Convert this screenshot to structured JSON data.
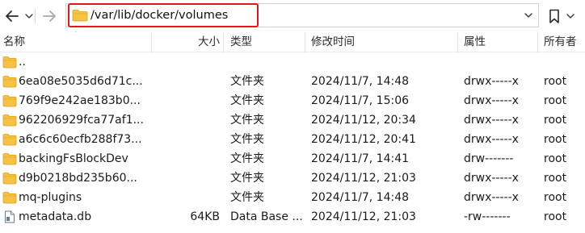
{
  "toolbar": {
    "back_icon": "arrow-left-icon",
    "forward_icon": "arrow-right-icon",
    "address": "/var/lib/docker/volumes",
    "bookmark_icon": "bookmark-icon"
  },
  "columns": {
    "name": "名称",
    "size": "大小",
    "type": "类型",
    "modified": "修改时间",
    "permissions": "属性",
    "owner": "所有者"
  },
  "colors": {
    "folder": "#f5c242",
    "highlight": "#e8141b"
  },
  "files": [
    {
      "icon": "folder-icon",
      "name": "..",
      "size": "",
      "type": "",
      "modified": "",
      "permissions": "",
      "owner": ""
    },
    {
      "icon": "folder-icon",
      "name": "6ea08e5035d6d71c...",
      "size": "",
      "type": "文件夹",
      "modified": "2024/11/7, 14:48",
      "permissions": "drwx-----x",
      "owner": "root"
    },
    {
      "icon": "folder-icon",
      "name": "769f9e242ae183b0...",
      "size": "",
      "type": "文件夹",
      "modified": "2024/11/7, 15:06",
      "permissions": "drwx-----x",
      "owner": "root"
    },
    {
      "icon": "folder-icon",
      "name": "962206929fca77af1...",
      "size": "",
      "type": "文件夹",
      "modified": "2024/11/12, 20:34",
      "permissions": "drwx-----x",
      "owner": "root"
    },
    {
      "icon": "folder-icon",
      "name": "a6c6c60ecfb288f73...",
      "size": "",
      "type": "文件夹",
      "modified": "2024/11/12, 20:41",
      "permissions": "drwx-----x",
      "owner": "root"
    },
    {
      "icon": "folder-icon",
      "name": "backingFsBlockDev",
      "size": "",
      "type": "文件夹",
      "modified": "2024/11/7, 14:41",
      "permissions": "drw-------",
      "owner": "root"
    },
    {
      "icon": "folder-icon",
      "name": "d9b0218bd235b60...",
      "size": "",
      "type": "文件夹",
      "modified": "2024/11/12, 21:03",
      "permissions": "drwx-----x",
      "owner": "root"
    },
    {
      "icon": "folder-icon",
      "name": "mq-plugins",
      "size": "",
      "type": "文件夹",
      "modified": "2024/11/7, 14:48",
      "permissions": "drwx-----x",
      "owner": "root"
    },
    {
      "icon": "file-icon",
      "name": "metadata.db",
      "size": "64KB",
      "type": "Data Base ...",
      "modified": "2024/11/12, 21:03",
      "permissions": "-rw-------",
      "owner": "root"
    }
  ]
}
